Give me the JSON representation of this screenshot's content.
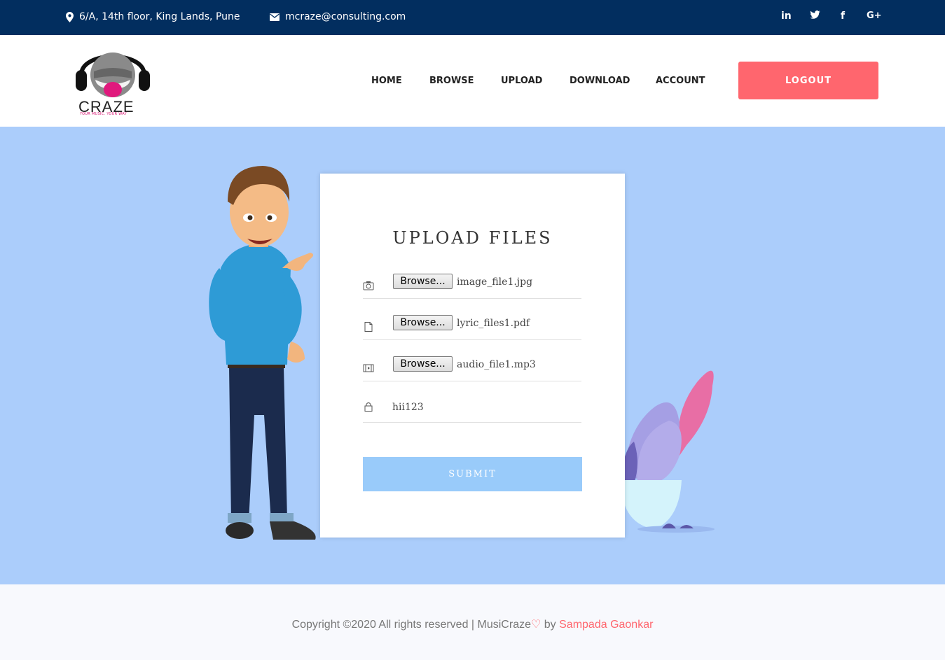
{
  "topbar": {
    "address": "6/A, 14th floor, King Lands, Pune",
    "email": "mcraze@consulting.com",
    "social": [
      "in",
      "twitter",
      "f",
      "G+"
    ]
  },
  "header": {
    "logo_word": "CRAZE",
    "logo_tagline": "YOUR MUSIC. YOUR WAY",
    "nav": [
      "HOME",
      "BROWSE",
      "UPLOAD",
      "DOWNLOAD",
      "ACCOUNT"
    ],
    "logout_label": "LOGOUT"
  },
  "form": {
    "title": "UPLOAD FILES",
    "browse_label": "Browse...",
    "files": [
      {
        "icon": "camera-icon",
        "name": "image_file1.jpg"
      },
      {
        "icon": "document-icon",
        "name": "lyric_files1.pdf"
      },
      {
        "icon": "film-icon",
        "name": "audio_file1.mp3"
      }
    ],
    "password": {
      "icon": "lock-icon",
      "value": "hii123"
    },
    "submit_label": "SUBMIT"
  },
  "footer": {
    "copyright": "Copyright ©2020 All rights reserved | MusiCraze",
    "heart": "♡",
    "by": " by ",
    "author": "Sampada Gaonkar"
  },
  "colors": {
    "topbar": "#022e5f",
    "accent": "#ff666e",
    "main_bg": "#abcdfb",
    "submit": "#99cbfa"
  }
}
